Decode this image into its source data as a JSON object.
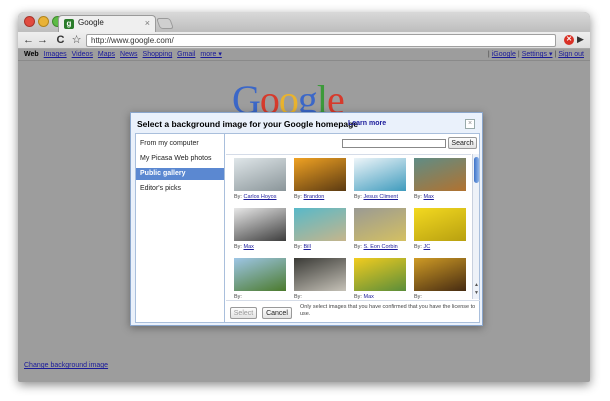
{
  "browser": {
    "tab_title": "Google",
    "tab_close": "×",
    "url": "http://www.google.com/",
    "back": "←",
    "forward": "→",
    "reload": "C",
    "star": "☆",
    "page_menu": "▶"
  },
  "google_bar": {
    "left_links": [
      "Web",
      "Images",
      "Videos",
      "Maps",
      "News",
      "Shopping",
      "Gmail",
      "more ▾"
    ],
    "right_links": [
      "iGoogle",
      "Settings ▾",
      "Sign out"
    ],
    "separator": "|"
  },
  "logo": {
    "letters": [
      "G",
      "o",
      "o",
      "g",
      "l",
      "e"
    ],
    "colors": [
      "#3b67c8",
      "#d63a2c",
      "#e9b32d",
      "#3b67c8",
      "#3c9a3a",
      "#d63a2c"
    ]
  },
  "change_background_link": "Change background image",
  "dialog": {
    "title": "Select a background image for your Google homepage",
    "learn_more": "Learn more",
    "close": "×",
    "sources": [
      "From my computer",
      "My Picasa Web photos",
      "Public gallery",
      "Editor's picks"
    ],
    "active_source": "Public gallery",
    "search_button": "Search",
    "search_value": "",
    "gallery": [
      {
        "by": "By:",
        "author": "Carlos Hoyos",
        "colors": [
          "#dfe6e9",
          "#8a9599"
        ]
      },
      {
        "by": "By:",
        "author": "Brandon",
        "colors": [
          "#f0a223",
          "#5b3a12"
        ]
      },
      {
        "by": "By:",
        "author": "Jesus Climent",
        "colors": [
          "#eef5f9",
          "#3f9bbd"
        ]
      },
      {
        "by": "By:",
        "author": "Max",
        "colors": [
          "#5f8d86",
          "#b2722f"
        ]
      },
      {
        "by": "By:",
        "author": "Max",
        "colors": [
          "#e8e8e8",
          "#3d3d3d"
        ]
      },
      {
        "by": "By:",
        "author": "Bill",
        "colors": [
          "#58b9c9",
          "#c6b58b"
        ]
      },
      {
        "by": "By:",
        "author": "S. Eon Corbin",
        "colors": [
          "#9a9a94",
          "#d4c062"
        ]
      },
      {
        "by": "By:",
        "author": "JC",
        "colors": [
          "#f3d920",
          "#b8a010"
        ]
      },
      {
        "by": "By:",
        "author": "",
        "colors": [
          "#9ec6e6",
          "#4b7a2c"
        ]
      },
      {
        "by": "By:",
        "author": "",
        "colors": [
          "#3a3a36",
          "#c6c2b8"
        ]
      },
      {
        "by": "By:",
        "author": "Max",
        "colors": [
          "#f2cc1f",
          "#5a8d3a"
        ]
      },
      {
        "by": "By:",
        "author": "",
        "colors": [
          "#cf9b25",
          "#462b12"
        ]
      }
    ],
    "select_button": "Select",
    "cancel_button": "Cancel",
    "license_note": "Only select images that you have confirmed that you have the license to use."
  }
}
